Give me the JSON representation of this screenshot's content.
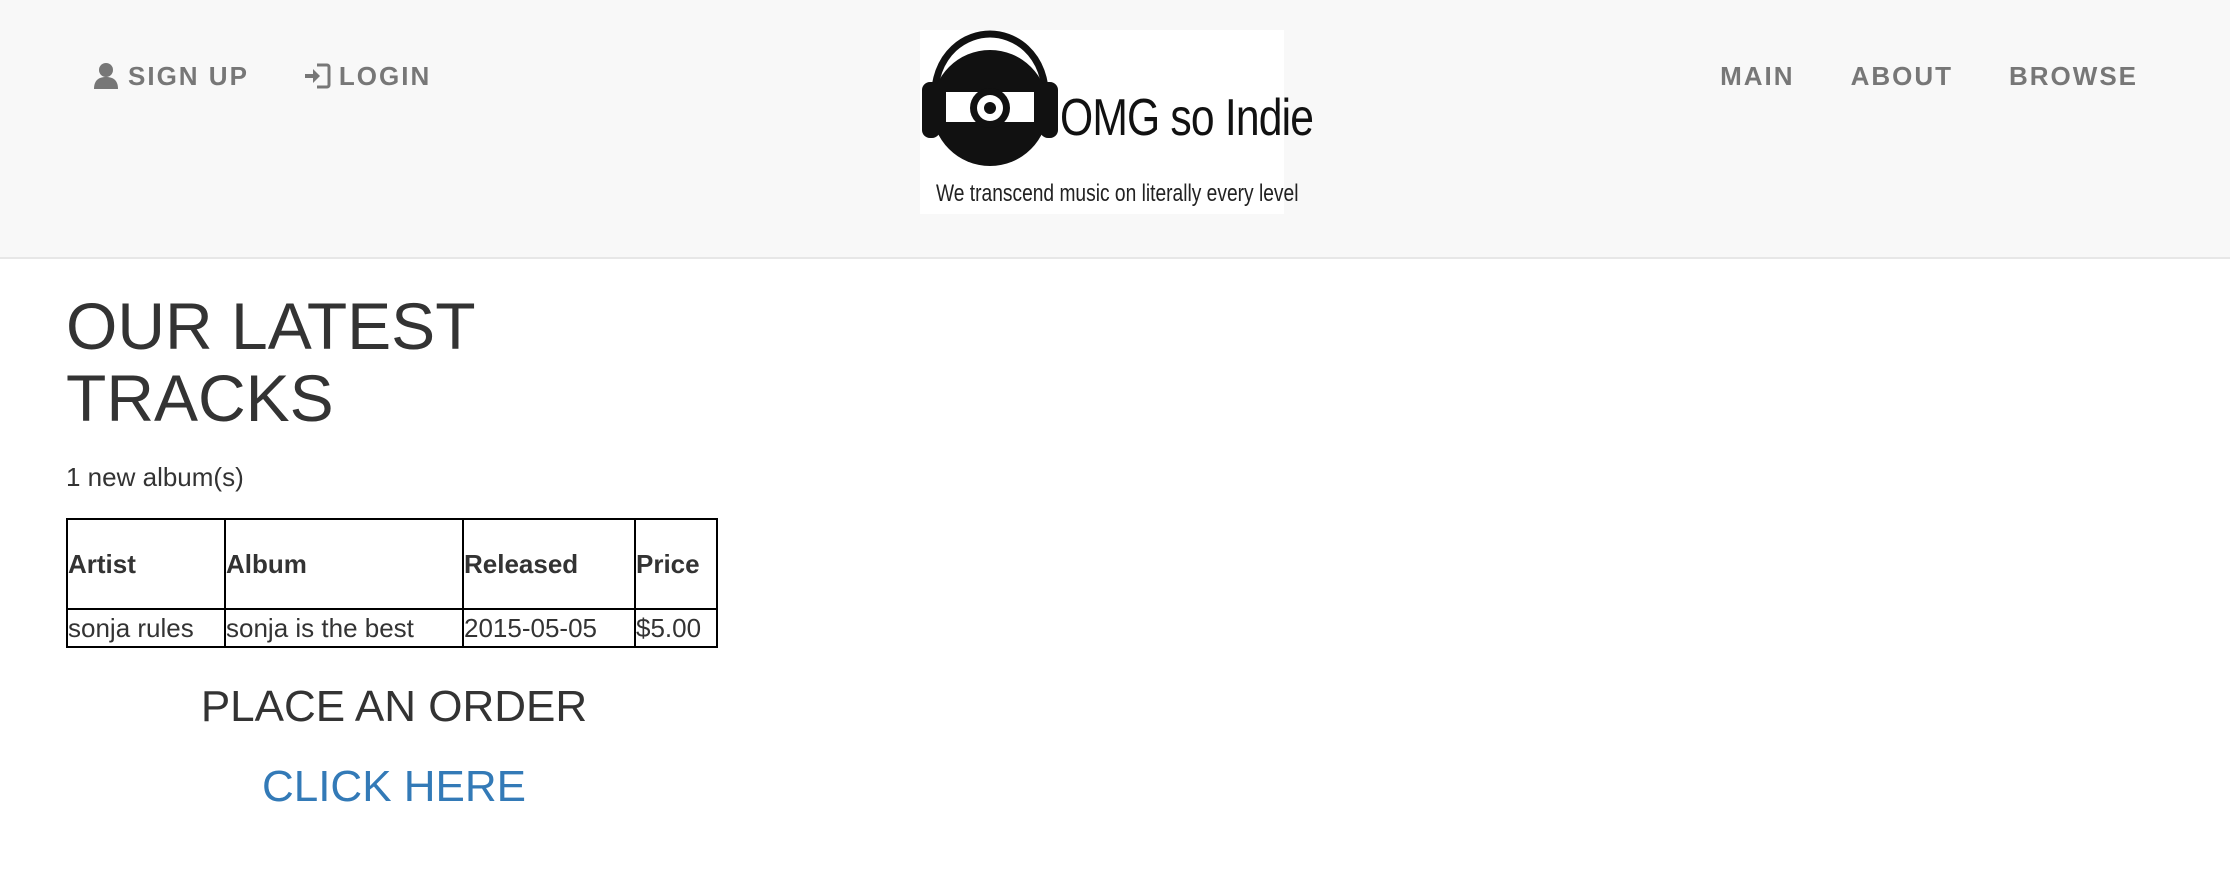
{
  "nav": {
    "left": [
      {
        "label": "SIGN UP",
        "icon": "user-icon"
      },
      {
        "label": "LOGIN",
        "icon": "login-icon"
      }
    ],
    "right": [
      {
        "label": "MAIN"
      },
      {
        "label": "ABOUT"
      },
      {
        "label": "BROWSE"
      }
    ]
  },
  "logo": {
    "name": "OMG so Indie",
    "tagline": "We transcend music on literally every level",
    "icon": "vinyl-headphones-icon"
  },
  "main": {
    "title": "OUR LATEST TRACKS",
    "album_count": "1 new album(s)",
    "table": {
      "headers": [
        "Artist",
        "Album",
        "Released",
        "Price"
      ],
      "rows": [
        [
          "sonja rules",
          "sonja is the best",
          "2015-05-05",
          "$5.00"
        ]
      ]
    },
    "order_heading": "PLACE AN ORDER",
    "order_link": "CLICK HERE"
  },
  "colors": {
    "navbar_bg": "#f8f8f8",
    "nav_text": "#777777",
    "text": "#333333",
    "link": "#337ab7"
  }
}
